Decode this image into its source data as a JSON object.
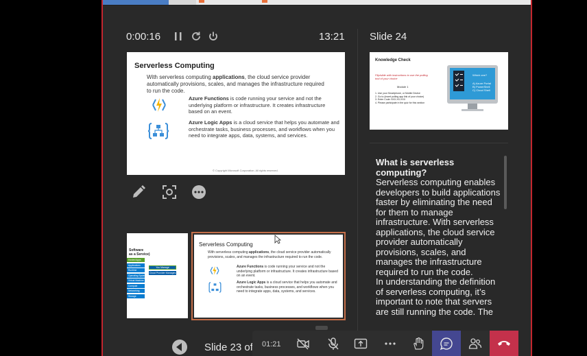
{
  "presenter": {
    "elapsed": "0:00:16",
    "clock": "13:21",
    "next_slide_title": "Slide 24",
    "counter": "Slide 23 of"
  },
  "current_slide": {
    "title": "Serverless Computing",
    "intro_a": "With serverless computing ",
    "intro_b": "applications",
    "intro_c": ", the cloud service provider automatically provisions, scales, and manages the infrastructure required to run the code.",
    "func_name": "Azure Functions",
    "func_text": " is code running your service and not the underlying platform or infrastructure. It creates infrastructure based on an event.",
    "logic_name": "Azure Logic Apps",
    "logic_text": " is a cloud service that helps you automate and orchestrate tasks, business processes, and workflows when you need to integrate apps, data, systems, and services.",
    "footer": "© Copyright Microsoft Corporation. All rights reserved."
  },
  "thumbnail_prev": {
    "title_line1": "Software",
    "title_line2": "as a Service)",
    "stack": [
      "Hosted Apps",
      "Applications",
      "Runtime",
      "Operating System",
      "Virtual Machine",
      "Compute",
      "Networking",
      "Storage"
    ],
    "you_manage": "You Manage",
    "provider_manages": "Cloud Provider Manages"
  },
  "next_slide": {
    "title": "Knowledge Check",
    "instructions": "Flip/slide with instructions to use the polling tool of your choice",
    "module": "Module 1",
    "steps": [
      "1. Use your Smartphone, or Mobile Device",
      "2. Go to (insert polling app link of your choice)",
      "3. Enter Code: 5XX-XX-XXX",
      "4. Please participate in the quiz for this section"
    ],
    "quiz_q": "Which one?",
    "quiz_a": "A) Azure Portal",
    "quiz_b": "B) PowerShell",
    "quiz_c": "C) Cloud Shell"
  },
  "notes": {
    "question": "What is serverless computing?",
    "body1": "Serverless computing enables developers to build applications faster by eliminating the need for them to manage infrastructure. With serverless applications, the cloud service provider automatically provisions, scales, and manages the infrastructure required to run the code.",
    "body2": "In understanding the definition of serverless computing, it’s important to note that servers are still running the code. The"
  },
  "call": {
    "duration": "01:21"
  },
  "colors": {
    "accent_red": "#c4262e",
    "chat_active": "#444791",
    "hangup": "#c4314b",
    "slide_outline": "#c46e49"
  }
}
